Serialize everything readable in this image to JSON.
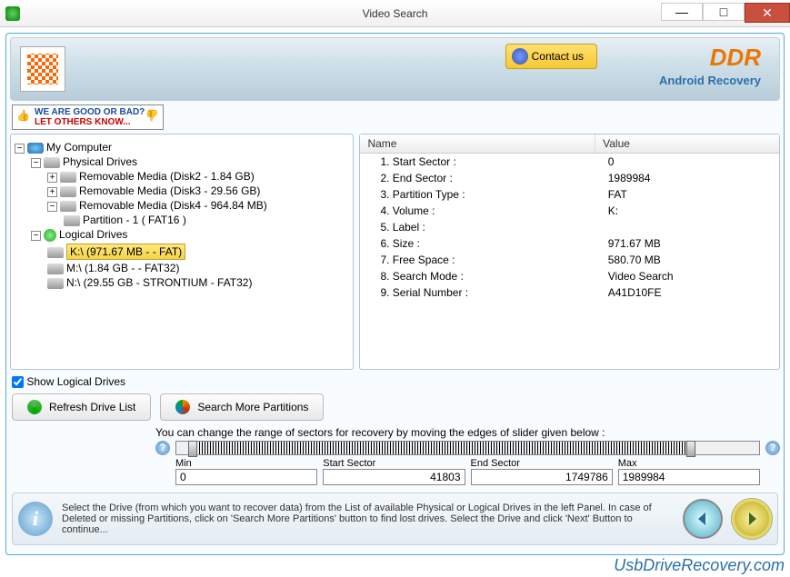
{
  "window": {
    "title": "Video Search"
  },
  "banner": {
    "contact": "Contact us",
    "brand": "DDR",
    "sub": "Android Recovery"
  },
  "feedback": {
    "l1": "WE ARE GOOD OR BAD?",
    "l2": "LET OTHERS KNOW..."
  },
  "tree": {
    "root": "My Computer",
    "physical": "Physical Drives",
    "disk2": "Removable Media (Disk2 - 1.84 GB)",
    "disk3": "Removable Media (Disk3 - 29.56 GB)",
    "disk4": "Removable Media (Disk4 - 964.84 MB)",
    "part1": "Partition - 1 ( FAT16 )",
    "logical": "Logical Drives",
    "k": "K:\\ (971.67 MB -  - FAT)",
    "m": "M:\\ (1.84 GB -  - FAT32)",
    "n": "N:\\ (29.55 GB - STRONTIUM - FAT32)"
  },
  "details": {
    "hName": "Name",
    "hValue": "Value",
    "rows": [
      {
        "n": "1. Start Sector :",
        "v": "0"
      },
      {
        "n": "2. End Sector :",
        "v": "1989984"
      },
      {
        "n": "3. Partition Type :",
        "v": "FAT"
      },
      {
        "n": "4. Volume :",
        "v": "K:"
      },
      {
        "n": "5. Label :",
        "v": ""
      },
      {
        "n": "6. Size :",
        "v": "971.67 MB"
      },
      {
        "n": "7. Free Space :",
        "v": "580.70 MB"
      },
      {
        "n": "8. Search Mode :",
        "v": "Video Search"
      },
      {
        "n": "9. Serial Number :",
        "v": "A41D10FE"
      }
    ]
  },
  "controls": {
    "showLogical": "Show Logical Drives",
    "refresh": "Refresh Drive List",
    "searchMore": "Search More Partitions"
  },
  "slider": {
    "note": "You can change the range of sectors for recovery by moving the edges of slider given below :",
    "minL": "Min",
    "min": "0",
    "startL": "Start Sector",
    "start": "41803",
    "endL": "End Sector",
    "end": "1749786",
    "maxL": "Max",
    "max": "1989984"
  },
  "footer": {
    "msg": "Select the Drive (from which you want to recover data) from the List of available Physical or Logical Drives in the left Panel. In case of Deleted or missing Partitions, click on 'Search More Partitions' button to find lost drives. Select the Drive and click 'Next' Button to continue..."
  },
  "watermark": "UsbDriveRecovery.com"
}
